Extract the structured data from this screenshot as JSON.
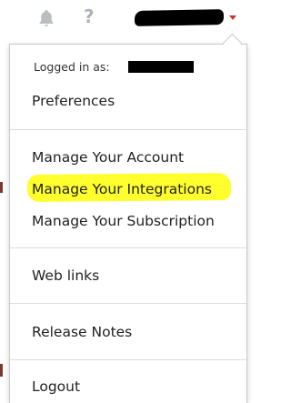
{
  "topbar": {
    "bell_icon": "bell-icon",
    "help_label": "?",
    "caret_color": "#c0392b"
  },
  "menu": {
    "logged_in_label": "Logged in as:",
    "items": {
      "preferences": "Preferences",
      "manage_account": "Manage Your Account",
      "manage_integrations": "Manage Your Integrations",
      "manage_subscription": "Manage Your Subscription",
      "web_links": "Web links",
      "release_notes": "Release Notes",
      "logout": "Logout"
    },
    "highlight_color": "#ffff2e"
  }
}
